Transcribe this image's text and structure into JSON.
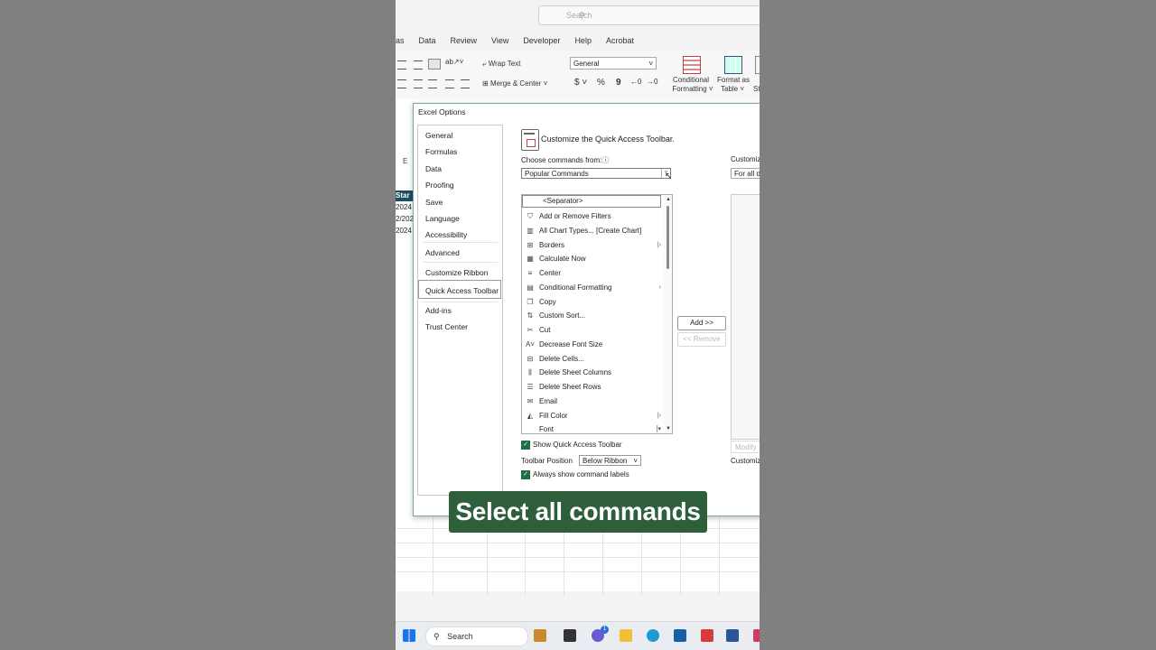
{
  "search": {
    "placeholder": "Search"
  },
  "tabs": [
    "as",
    "Data",
    "Review",
    "View",
    "Developer",
    "Help",
    "Acrobat"
  ],
  "ribbon": {
    "wrap_text": "Wrap Text",
    "merge_center": "Merge & Center",
    "number_format": "General",
    "currency": "$",
    "percent": "%",
    "comma": "9",
    "conditional_formatting_1": "Conditional",
    "conditional_formatting_2": "Formatting",
    "format_as_table_1": "Format as",
    "format_as_table_2": "Table",
    "styles_partial": "St"
  },
  "sheet": {
    "col_e": "E",
    "start_header": "Star",
    "cells": [
      "2024",
      "2/202",
      "2024"
    ]
  },
  "dialog": {
    "title": "Excel Options",
    "nav": [
      "General",
      "Formulas",
      "Data",
      "Proofing",
      "Save",
      "Language",
      "Accessibility",
      "Advanced",
      "Customize Ribbon",
      "Quick Access Toolbar",
      "Add-ins",
      "Trust Center"
    ],
    "heading": "Customize the Quick Access Toolbar.",
    "choose_label": "Choose commands from:",
    "choose_info": "ⓘ",
    "choose_value": "Popular Commands",
    "customize_label": "Customiz",
    "for_all_value": "For all d",
    "separator": "<Separator>",
    "commands": [
      {
        "label": "Add or Remove Filters",
        "icon": "filter-icon",
        "glyph": "⛉",
        "sub": ""
      },
      {
        "label": "All Chart Types... [Create Chart]",
        "icon": "chart-icon",
        "glyph": "▥",
        "sub": ""
      },
      {
        "label": "Borders",
        "icon": "borders-icon",
        "glyph": "⊞",
        "sub": "|›"
      },
      {
        "label": "Calculate Now",
        "icon": "calculator-icon",
        "glyph": "▦",
        "sub": ""
      },
      {
        "label": "Center",
        "icon": "align-center-icon",
        "glyph": "≡",
        "sub": ""
      },
      {
        "label": "Conditional Formatting",
        "icon": "conditional-formatting-icon",
        "glyph": "▤",
        "sub": "›"
      },
      {
        "label": "Copy",
        "icon": "copy-icon",
        "glyph": "❐",
        "sub": ""
      },
      {
        "label": "Custom Sort...",
        "icon": "sort-icon",
        "glyph": "⇅",
        "sub": ""
      },
      {
        "label": "Cut",
        "icon": "scissors-icon",
        "glyph": "✂",
        "sub": ""
      },
      {
        "label": "Decrease Font Size",
        "icon": "decrease-font-icon",
        "glyph": "A˅",
        "sub": ""
      },
      {
        "label": "Delete Cells...",
        "icon": "delete-cells-icon",
        "glyph": "⊟",
        "sub": ""
      },
      {
        "label": "Delete Sheet Columns",
        "icon": "delete-columns-icon",
        "glyph": "⫼",
        "sub": ""
      },
      {
        "label": "Delete Sheet Rows",
        "icon": "delete-rows-icon",
        "glyph": "☰",
        "sub": ""
      },
      {
        "label": "Email",
        "icon": "email-icon",
        "glyph": "✉",
        "sub": ""
      },
      {
        "label": "Fill Color",
        "icon": "fill-color-icon",
        "glyph": "◭",
        "sub": "|›"
      },
      {
        "label": "Font",
        "icon": "font-icon",
        "glyph": "",
        "sub": "[▾"
      }
    ],
    "add_button": "Add >>",
    "remove_button": "<< Remove",
    "modify_button": "Modify",
    "customize2": "Customiza",
    "show_qat": "Show Quick Access Toolbar",
    "toolbar_position_label": "Toolbar Position",
    "toolbar_position_value": "Below Ribbon",
    "always_show_labels": "Always show command labels"
  },
  "caption": "Select all commands",
  "taskbar": {
    "search": "Search",
    "badge": "1"
  }
}
